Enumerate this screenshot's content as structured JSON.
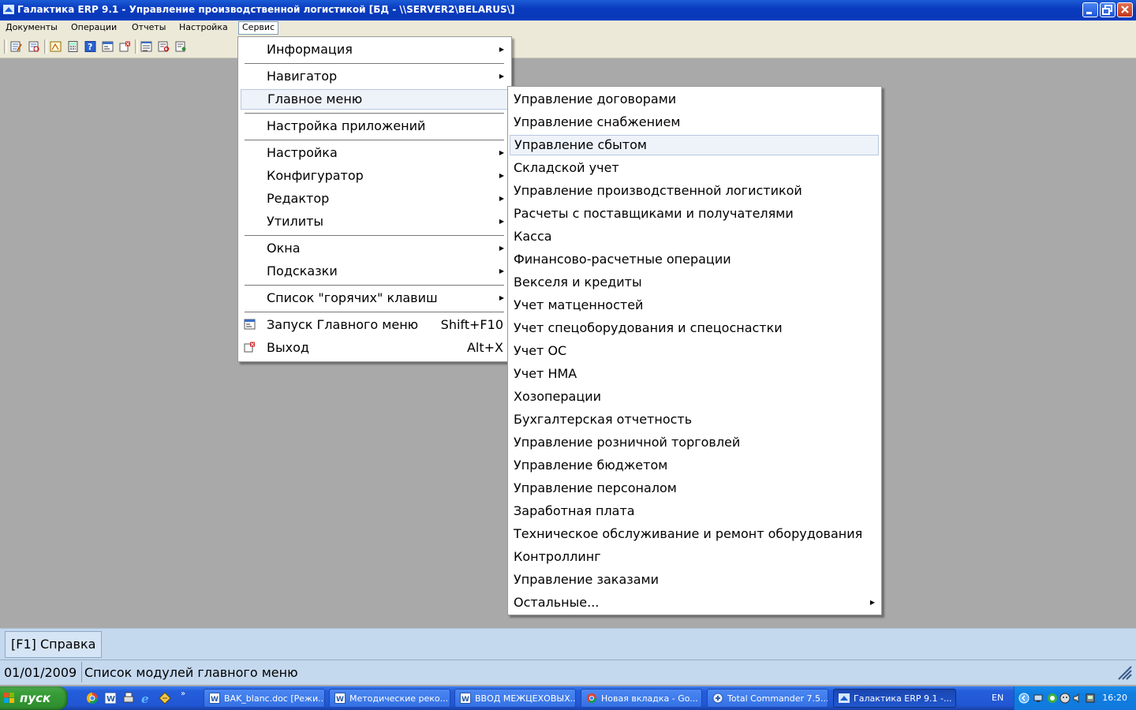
{
  "window": {
    "title": "Галактика ERP 9.1 - Управление производственной логистикой [БД - \\\\SERVER2\\BELARUS\\]"
  },
  "menubar": [
    "Документы",
    "Операции",
    "Отчеты",
    "Настройка",
    "Сервис"
  ],
  "service_menu": {
    "items": [
      {
        "label": "Информация",
        "shortcut": "",
        "submenu": true
      },
      {
        "label": "Навигатор",
        "shortcut": "",
        "submenu": true
      },
      {
        "label": "Главное меню",
        "shortcut": "",
        "submenu": false
      },
      {
        "label": "Настройка приложений",
        "shortcut": "",
        "submenu": false
      },
      {
        "label": "Настройка",
        "shortcut": "",
        "submenu": true
      },
      {
        "label": "Конфигуратор",
        "shortcut": "",
        "submenu": true
      },
      {
        "label": "Редактор",
        "shortcut": "",
        "submenu": true
      },
      {
        "label": "Утилиты",
        "shortcut": "",
        "submenu": true
      },
      {
        "label": "Окна",
        "shortcut": "",
        "submenu": true
      },
      {
        "label": "Подсказки",
        "shortcut": "",
        "submenu": true
      },
      {
        "label": "Список \"горячих\" клавиш",
        "shortcut": "",
        "submenu": true
      },
      {
        "label": "Запуск Главного меню",
        "shortcut": "Shift+F10",
        "submenu": false,
        "icon": "launch-menu-icon"
      },
      {
        "label": "Выход",
        "shortcut": "Alt+X",
        "submenu": false,
        "icon": "exit-icon"
      }
    ]
  },
  "main_menu_submenu": {
    "items": [
      "Управление договорами",
      "Управление снабжением",
      "Управление сбытом",
      "Складской учет",
      "Управление производственной логистикой",
      "Расчеты с поставщиками и получателями",
      "Касса",
      "Финансово-расчетные операции",
      "Векселя и кредиты",
      "Учет матценностей",
      "Учет спецоборудования и спецоснастки",
      "Учет ОС",
      "Учет НМА",
      "Хозоперации",
      "Бухгалтерская отчетность",
      "Управление розничной торговлей",
      "Управление бюджетом",
      "Управление персоналом",
      "Заработная плата",
      "Техническое обслуживание и ремонт оборудования",
      "Контроллинг",
      "Управление заказами",
      "Остальные..."
    ]
  },
  "helpbar": {
    "label": "[F1] Справка"
  },
  "status": {
    "date": "01/01/2009",
    "message": "Список модулей главного меню"
  },
  "taskbar": {
    "start_label": "пуск",
    "buttons": [
      "BAK_blanc.doc [Режи...",
      "Методические реко...",
      "ВВОД МЕЖЦЕХОВЫХ...",
      "Новая вкладка - Go...",
      "Total Commander 7.5...",
      "Галактика ERP 9.1 -..."
    ],
    "lang": "EN",
    "clock": "16:20"
  },
  "colors": {
    "titlebar": "#0a3cc0",
    "workspace": "#a9a9a9",
    "taskbar": "#245edb",
    "start": "#379d37",
    "status": "#c4d8ee"
  }
}
